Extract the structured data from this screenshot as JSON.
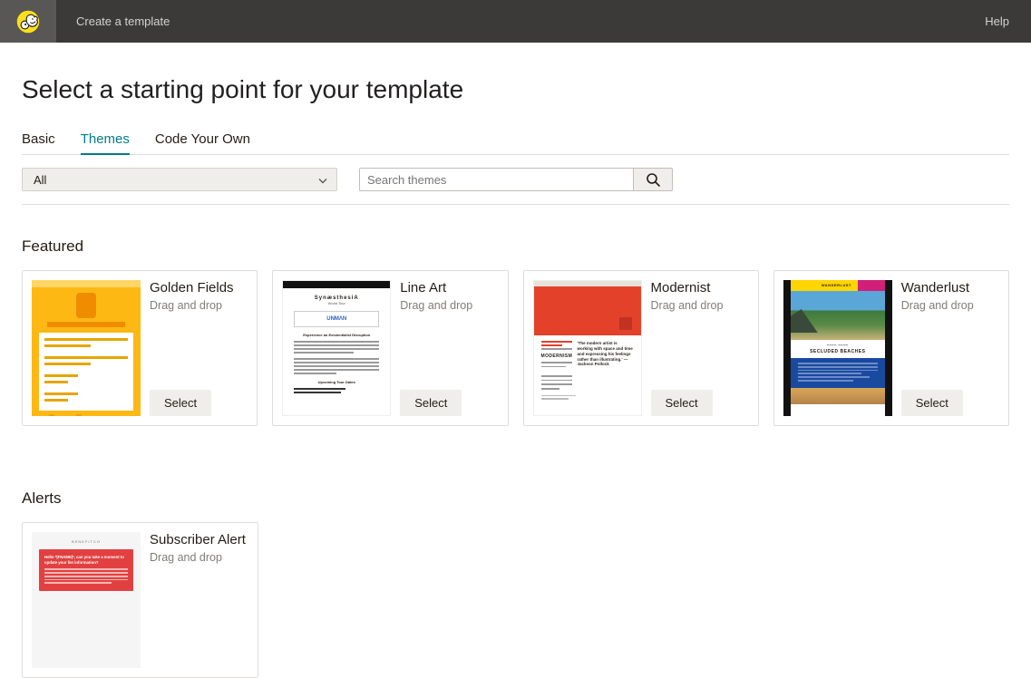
{
  "topbar": {
    "title": "Create a template",
    "help": "Help"
  },
  "page_title": "Select a starting point for your template",
  "tabs": [
    {
      "key": "basic",
      "label": "Basic",
      "active": false
    },
    {
      "key": "themes",
      "label": "Themes",
      "active": true
    },
    {
      "key": "code",
      "label": "Code Your Own",
      "active": false
    }
  ],
  "filter": {
    "dropdown_value": "All",
    "search_placeholder": "Search themes"
  },
  "select_label": "Select",
  "sections": {
    "featured": {
      "title": "Featured",
      "items": [
        {
          "key": "golden",
          "title": "Golden Fields",
          "sub": "Drag and drop"
        },
        {
          "key": "lineart",
          "title": "Line Art",
          "sub": "Drag and drop"
        },
        {
          "key": "modernist",
          "title": "Modernist",
          "sub": "Drag and drop"
        },
        {
          "key": "wanderlust",
          "title": "Wanderlust",
          "sub": "Drag and drop"
        }
      ]
    },
    "alerts": {
      "title": "Alerts",
      "items": [
        {
          "key": "subscriber-alert",
          "title": "Subscriber Alert",
          "sub": "Drag and drop"
        }
      ]
    }
  },
  "thumb_text": {
    "lineart_title": "SynæsthesiA",
    "lineart_sub": "World Tour",
    "lineart_logo": "UNMΛN",
    "lineart_tag": "Experience an Existentialist Disruption",
    "lineart_foot": "Upcoming Tour Dates",
    "modern_head": "MODERNISM",
    "modern_quote": "'The modern artist is working with space and time and expressing his feelings rather than illustrating.' — Jackson Pollock",
    "wander_brand": "WANDERLUST",
    "wander_head": "SECLUDED BEACHES",
    "alert_brand": "BENEFITCO",
    "alert_head": "Hello *|FNAME|*, can you take a moment to update your list information?"
  }
}
